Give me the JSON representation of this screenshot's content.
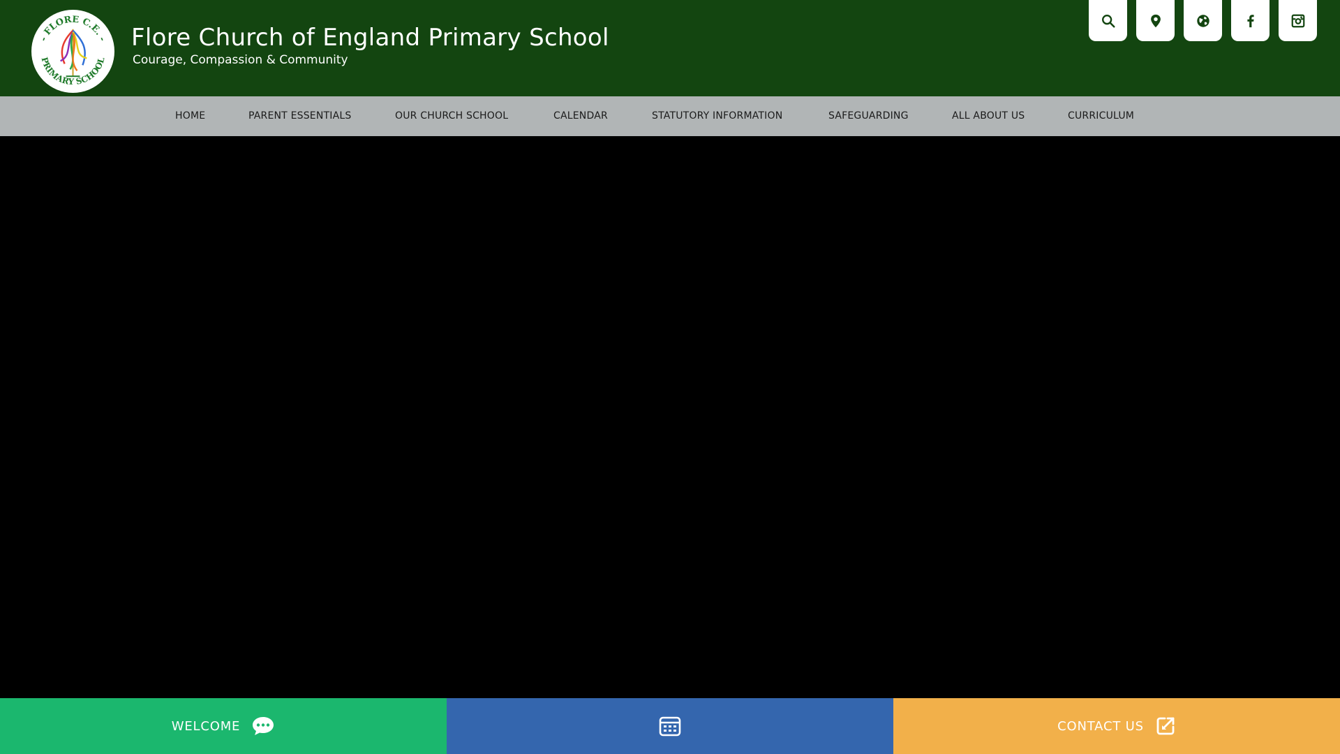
{
  "header": {
    "school_name": "Flore Church of England Primary School",
    "tagline": "Courage, Compassion & Community",
    "logo_text": "FLORE C.E. PRIMARY SCHOOL",
    "background_color": "#134510"
  },
  "quick_links": [
    {
      "icon": "search-icon"
    },
    {
      "icon": "location-pin-icon"
    },
    {
      "icon": "globe-icon"
    },
    {
      "icon": "facebook-icon"
    },
    {
      "icon": "instagram-icon"
    }
  ],
  "nav": {
    "items": [
      {
        "label": "HOME"
      },
      {
        "label": "PARENT ESSENTIALS"
      },
      {
        "label": "OUR CHURCH SCHOOL"
      },
      {
        "label": "CALENDAR"
      },
      {
        "label": "STATUTORY INFORMATION"
      },
      {
        "label": "SAFEGUARDING"
      },
      {
        "label": "ALL ABOUT US"
      },
      {
        "label": "CURRICULUM"
      }
    ],
    "background_color": "#b1b5b6"
  },
  "bottom_bar": {
    "welcome": {
      "label": "WELCOME",
      "icon": "speech-bubble-icon",
      "color": "#1bb76e"
    },
    "calendar": {
      "icon": "calendar-icon",
      "color": "#3466ae"
    },
    "contact": {
      "label": "CONTACT US",
      "icon": "external-link-icon",
      "color": "#f2b04a"
    }
  }
}
